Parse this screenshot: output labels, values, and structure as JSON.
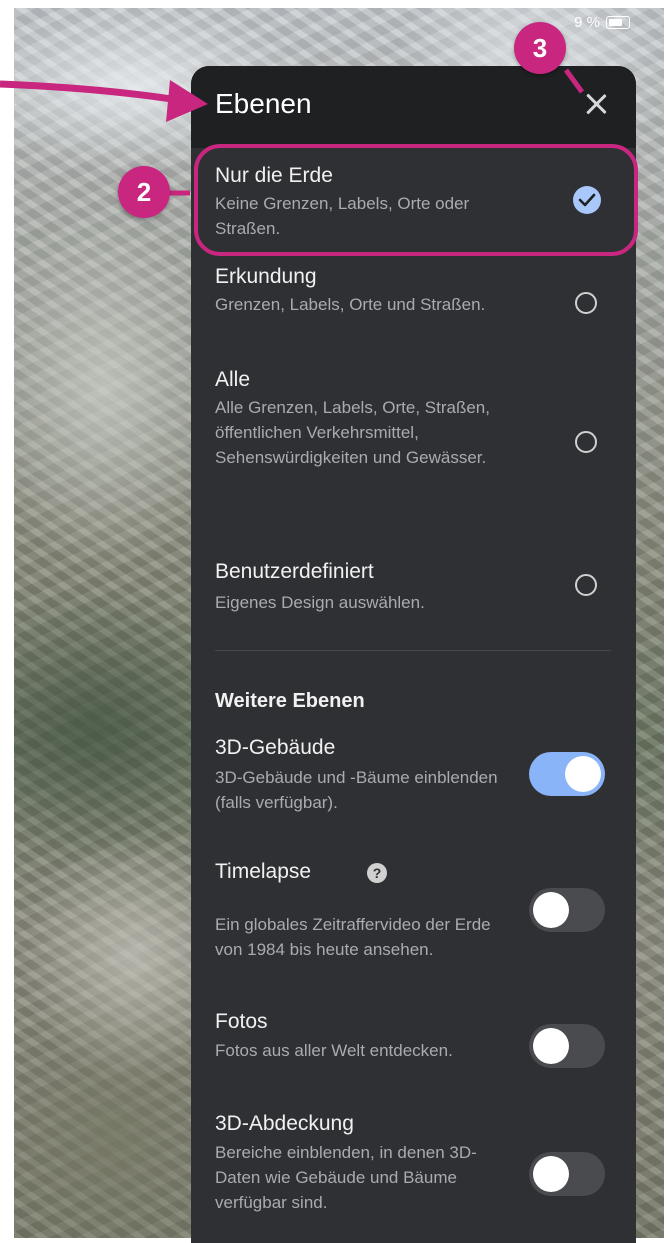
{
  "status_bar": {
    "battery_text": "9 %"
  },
  "panel": {
    "title": "Ebenen",
    "close_icon": "close-icon"
  },
  "map_styles": [
    {
      "title": "Nur die Erde",
      "description": "Keine Grenzen, Labels, Orte oder Straßen.",
      "selected": true
    },
    {
      "title": "Erkundung",
      "description": "Grenzen, Labels, Orte und Straßen.",
      "selected": false
    },
    {
      "title": "Alle",
      "description": "Alle Grenzen, Labels, Orte, Straßen, öffentlichen Verkehrsmittel, Sehenswürdigkeiten und Gewässer.",
      "selected": false
    },
    {
      "title": "Benutzerdefiniert",
      "description": "Eigenes Design auswählen.",
      "selected": false
    }
  ],
  "more_layers": {
    "heading": "Weitere Ebenen",
    "items": [
      {
        "title": "3D-Gebäude",
        "description": "3D-Gebäude und -Bäume einblenden (falls verfügbar).",
        "enabled": true
      },
      {
        "title": "Timelapse",
        "description": "Ein globales Zeitraffervideo der Erde von 1984 bis heute ansehen.",
        "enabled": false,
        "help_icon": "?"
      },
      {
        "title": "Fotos",
        "description": "Fotos aus aller Welt entdecken.",
        "enabled": false
      },
      {
        "title": "3D-Abdeckung",
        "description": "Bereiche einblenden, in denen 3D-Daten wie Gebäude und Bäume verfügbar sind.",
        "enabled": false
      }
    ]
  },
  "annotations": {
    "badge_2": "2",
    "badge_3": "3",
    "accent_color": "#c8267f"
  },
  "colors": {
    "panel_bg": "#2f3033",
    "header_bg": "#1f2022",
    "toggle_on": "#8ab4f8",
    "check_selected": "#a8c7fa"
  }
}
